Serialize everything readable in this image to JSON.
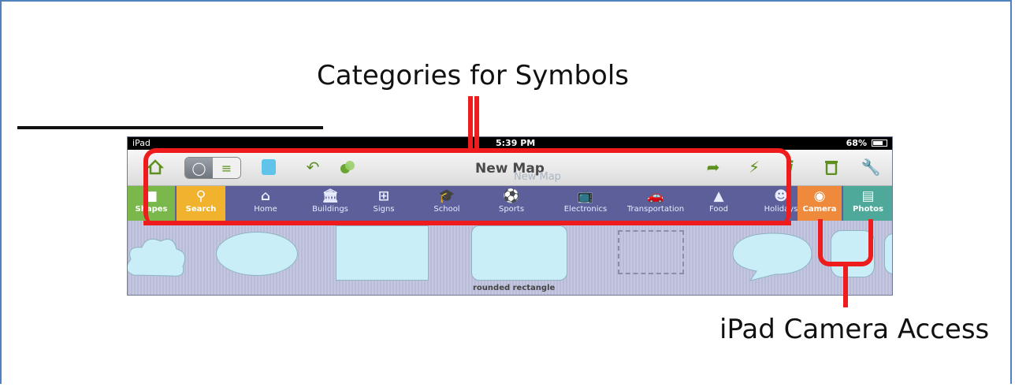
{
  "callouts": {
    "categories": "Categories for Symbols",
    "camera_access": "iPad Camera Access"
  },
  "status_bar": {
    "device": "iPad",
    "time": "5:39 PM",
    "battery": "68%"
  },
  "toolbar": {
    "title": "New Map",
    "ghost_title": "New Map",
    "icons": [
      "home-icon",
      "map-view-icon",
      "outline-view-icon",
      "symbol-icon",
      "undo-icon",
      "color-icon",
      "share-icon",
      "lightning-icon",
      "info-icon",
      "trash-icon",
      "wrench-icon"
    ]
  },
  "categories": [
    {
      "label": "Shapes",
      "icon": "shapes-icon"
    },
    {
      "label": "Search",
      "icon": "search-icon"
    },
    {
      "label": "Home",
      "icon": "home-icon"
    },
    {
      "label": "Buildings",
      "icon": "building-icon"
    },
    {
      "label": "Signs",
      "icon": "sign-icon"
    },
    {
      "label": "School",
      "icon": "graduation-cap-icon"
    },
    {
      "label": "Sports",
      "icon": "ball-icon"
    },
    {
      "label": "Electronics",
      "icon": "tv-icon"
    },
    {
      "label": "Transportation",
      "icon": "car-icon"
    },
    {
      "label": "Food",
      "icon": "cloche-icon"
    },
    {
      "label": "Holidays",
      "icon": "smiley-icon"
    },
    {
      "label": "Camera",
      "icon": "camera-icon"
    },
    {
      "label": "Photos",
      "icon": "photos-icon"
    }
  ],
  "tray": {
    "selected_label": "rounded rectangle"
  },
  "colors": {
    "annotation": "#ee1c1c",
    "category_bar": "#5c5f9a",
    "shapes_tab": "#7ab84b",
    "search_tab": "#f1b22e",
    "camera_tab": "#ef8a3c",
    "photos_tab": "#4fa99a"
  }
}
